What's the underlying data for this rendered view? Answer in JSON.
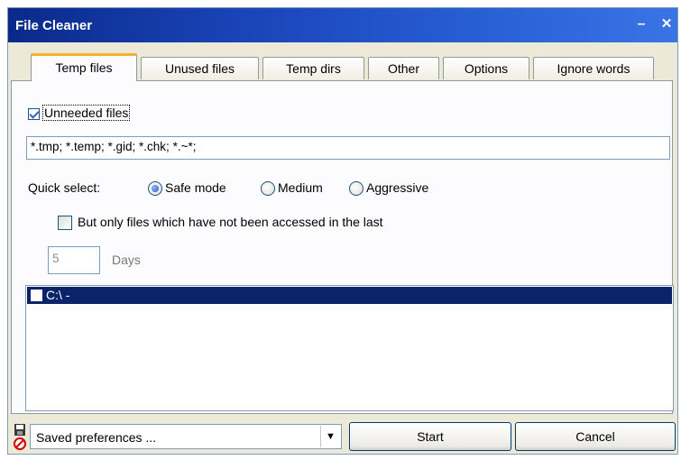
{
  "window": {
    "title": "File Cleaner",
    "minimize_glyph": "–",
    "close_glyph": "✕"
  },
  "tabs": [
    {
      "label": "Temp files",
      "active": true
    },
    {
      "label": "Unused files",
      "active": false
    },
    {
      "label": "Temp dirs",
      "active": false
    },
    {
      "label": "Other",
      "active": false
    },
    {
      "label": "Options",
      "active": false
    },
    {
      "label": "Ignore words",
      "active": false
    }
  ],
  "panel": {
    "unneeded_files": {
      "label": "Unneeded files",
      "checked": true
    },
    "patterns_value": "*.tmp; *.temp; *.gid; *.chk; *.~*;",
    "quick_select": {
      "label": "Quick select:",
      "options": [
        {
          "label": "Safe mode",
          "selected": true
        },
        {
          "label": "Medium",
          "selected": false
        },
        {
          "label": "Aggressive",
          "selected": false
        }
      ]
    },
    "access_filter": {
      "label": "But only files which have not been accessed in the last",
      "checked": false
    },
    "days": {
      "value": "5",
      "unit_label": "Days"
    },
    "drives": [
      {
        "label": "C:\\ -",
        "checked": false,
        "selected": true
      }
    ]
  },
  "bottom": {
    "preferences_combo_value": "Saved preferences ...",
    "dropdown_glyph": "▼",
    "start_label": "Start",
    "cancel_label": "Cancel",
    "icons": [
      "disk-icon",
      "no-entry-icon"
    ]
  },
  "colors": {
    "titlebar": "#0a2a8a",
    "selection": "#0a246a",
    "active_tab_accent": "#f7b132"
  }
}
